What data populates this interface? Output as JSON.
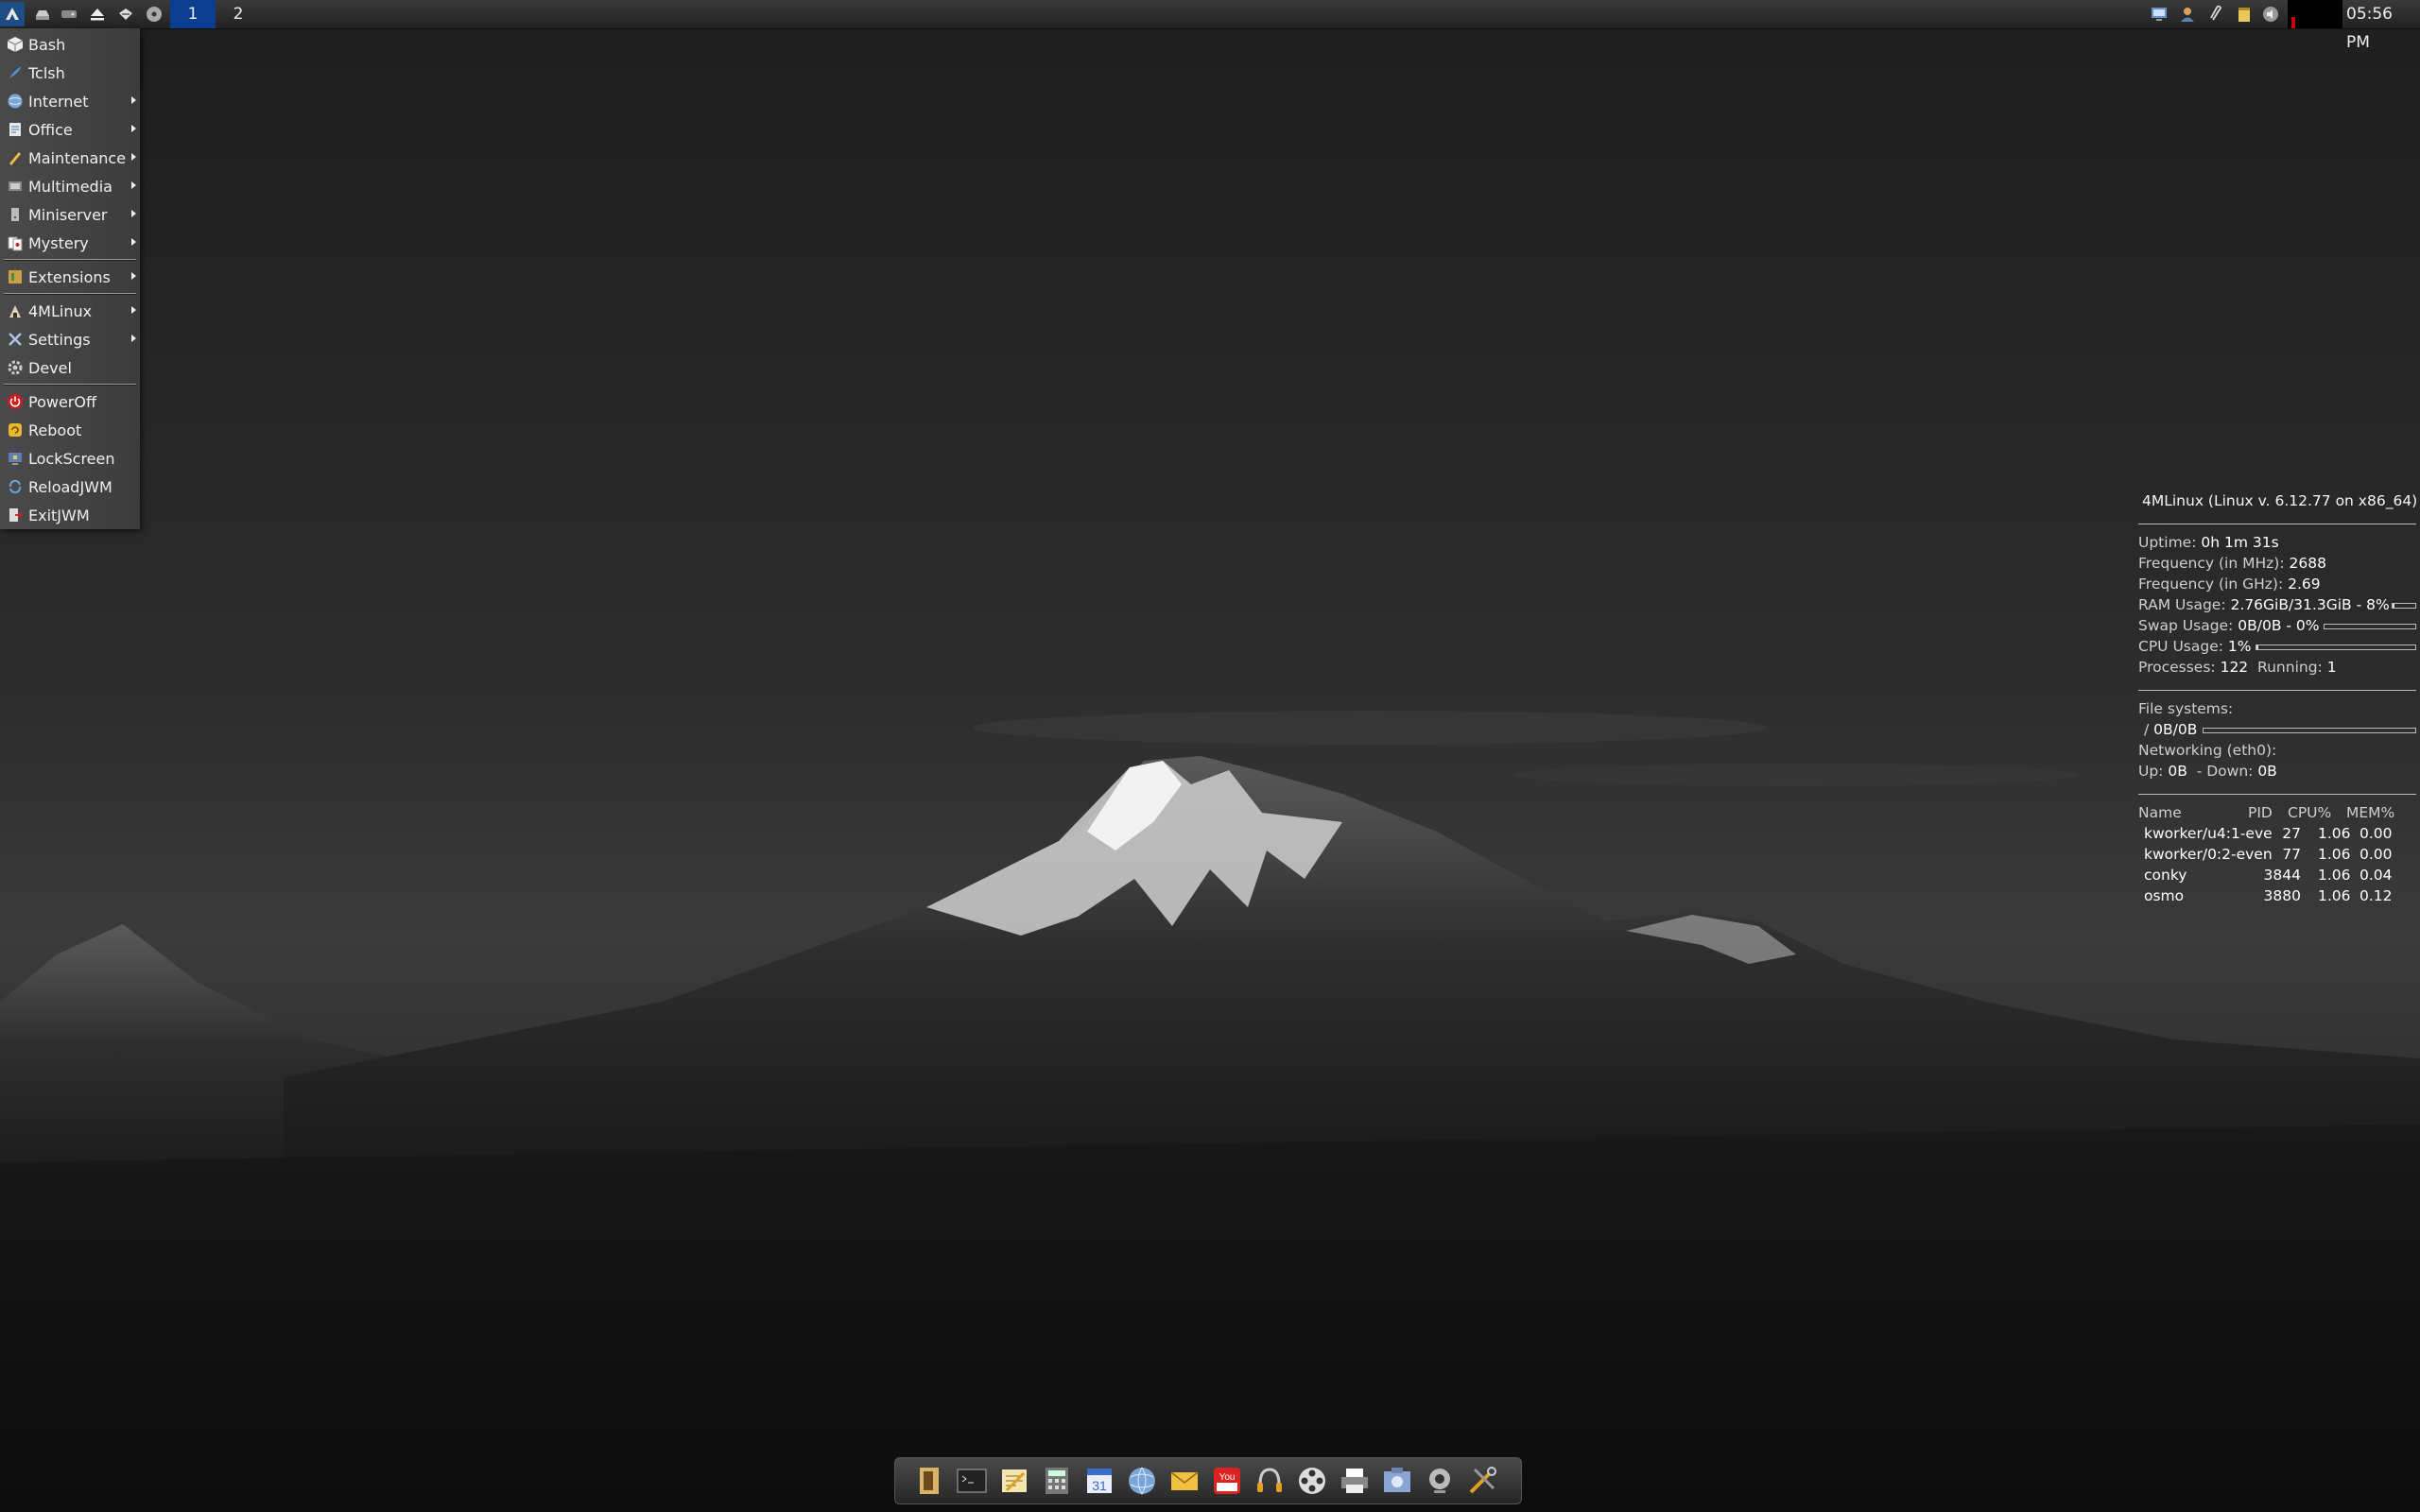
{
  "panel": {
    "workspaces": [
      "1",
      "2"
    ],
    "clock": "05:56 PM",
    "launcher_icons": [
      "4mlinux-start-icon",
      "drive-icon",
      "hdd-icon",
      "eject-icon",
      "network-icon",
      "disc-icon"
    ],
    "tray_icons": [
      "network-monitor-icon",
      "user-icon",
      "clipboard-icon",
      "notes-icon",
      "volume-icon"
    ]
  },
  "menu": {
    "items": [
      {
        "label": "Bash"
      },
      {
        "label": "Tclsh"
      },
      {
        "label": "Internet"
      },
      {
        "label": "Office"
      },
      {
        "label": "Maintenance"
      },
      {
        "label": "Multimedia"
      },
      {
        "label": "Miniserver"
      },
      {
        "label": "Mystery"
      },
      {
        "label": "Extensions"
      },
      {
        "label": "4MLinux"
      },
      {
        "label": "Settings"
      },
      {
        "label": "Devel"
      },
      {
        "label": "PowerOff"
      },
      {
        "label": "Reboot"
      },
      {
        "label": "LockScreen"
      },
      {
        "label": "ReloadJWM"
      },
      {
        "label": "ExitJWM"
      }
    ]
  },
  "conky": {
    "header": "4MLinux (Linux v. 6.12.77 on x86_64)",
    "uptime_label": "Uptime:",
    "uptime": "0h 1m 31s",
    "freq_mhz_label": "Frequency (in MHz):",
    "freq_mhz": "2688",
    "freq_ghz_label": "Frequency (in GHz):",
    "freq_ghz": "2.69",
    "ram_label": "RAM Usage:",
    "ram": "2.76GiB/31.3GiB - 8%",
    "ram_fraction": 0.08,
    "swap_label": "Swap Usage:",
    "swap": "0B/0B - 0%",
    "swap_fraction": 0,
    "cpu_label": "CPU Usage:",
    "cpu": "1%",
    "cpu_fraction": 0.01,
    "proc_label": "Processes:",
    "processes": "122",
    "running_label": "Running:",
    "running": "1",
    "fs_label": "File systems:",
    "fs_mount": "/",
    "fs_value": "0B/0B",
    "fs_fraction": 0,
    "net_label": "Networking (eth0):",
    "up_label": "Up:",
    "up": "0B",
    "down_label": "- Down:",
    "down": "0B",
    "proc_headers": [
      "Name",
      "PID",
      "CPU%",
      "MEM%"
    ],
    "process_rows": [
      {
        "name": "kworker/u4:1-eve",
        "pid": "27",
        "cpu": "1.06",
        "mem": "0.00"
      },
      {
        "name": "kworker/0:2-even",
        "pid": "77",
        "cpu": "1.06",
        "mem": "0.00"
      },
      {
        "name": "conky",
        "pid": "3844",
        "cpu": "1.06",
        "mem": "0.04"
      },
      {
        "name": "osmo",
        "pid": "3880",
        "cpu": "1.06",
        "mem": "0.12"
      }
    ]
  },
  "dock": {
    "apps": [
      "file-manager-icon",
      "terminal-icon",
      "text-editor-icon",
      "calculator-icon",
      "calendar-icon",
      "web-browser-icon",
      "mail-icon",
      "youtube-icon",
      "audio-player-icon",
      "video-player-icon",
      "printer-icon",
      "image-viewer-icon",
      "webcam-icon",
      "tools-icon"
    ]
  }
}
